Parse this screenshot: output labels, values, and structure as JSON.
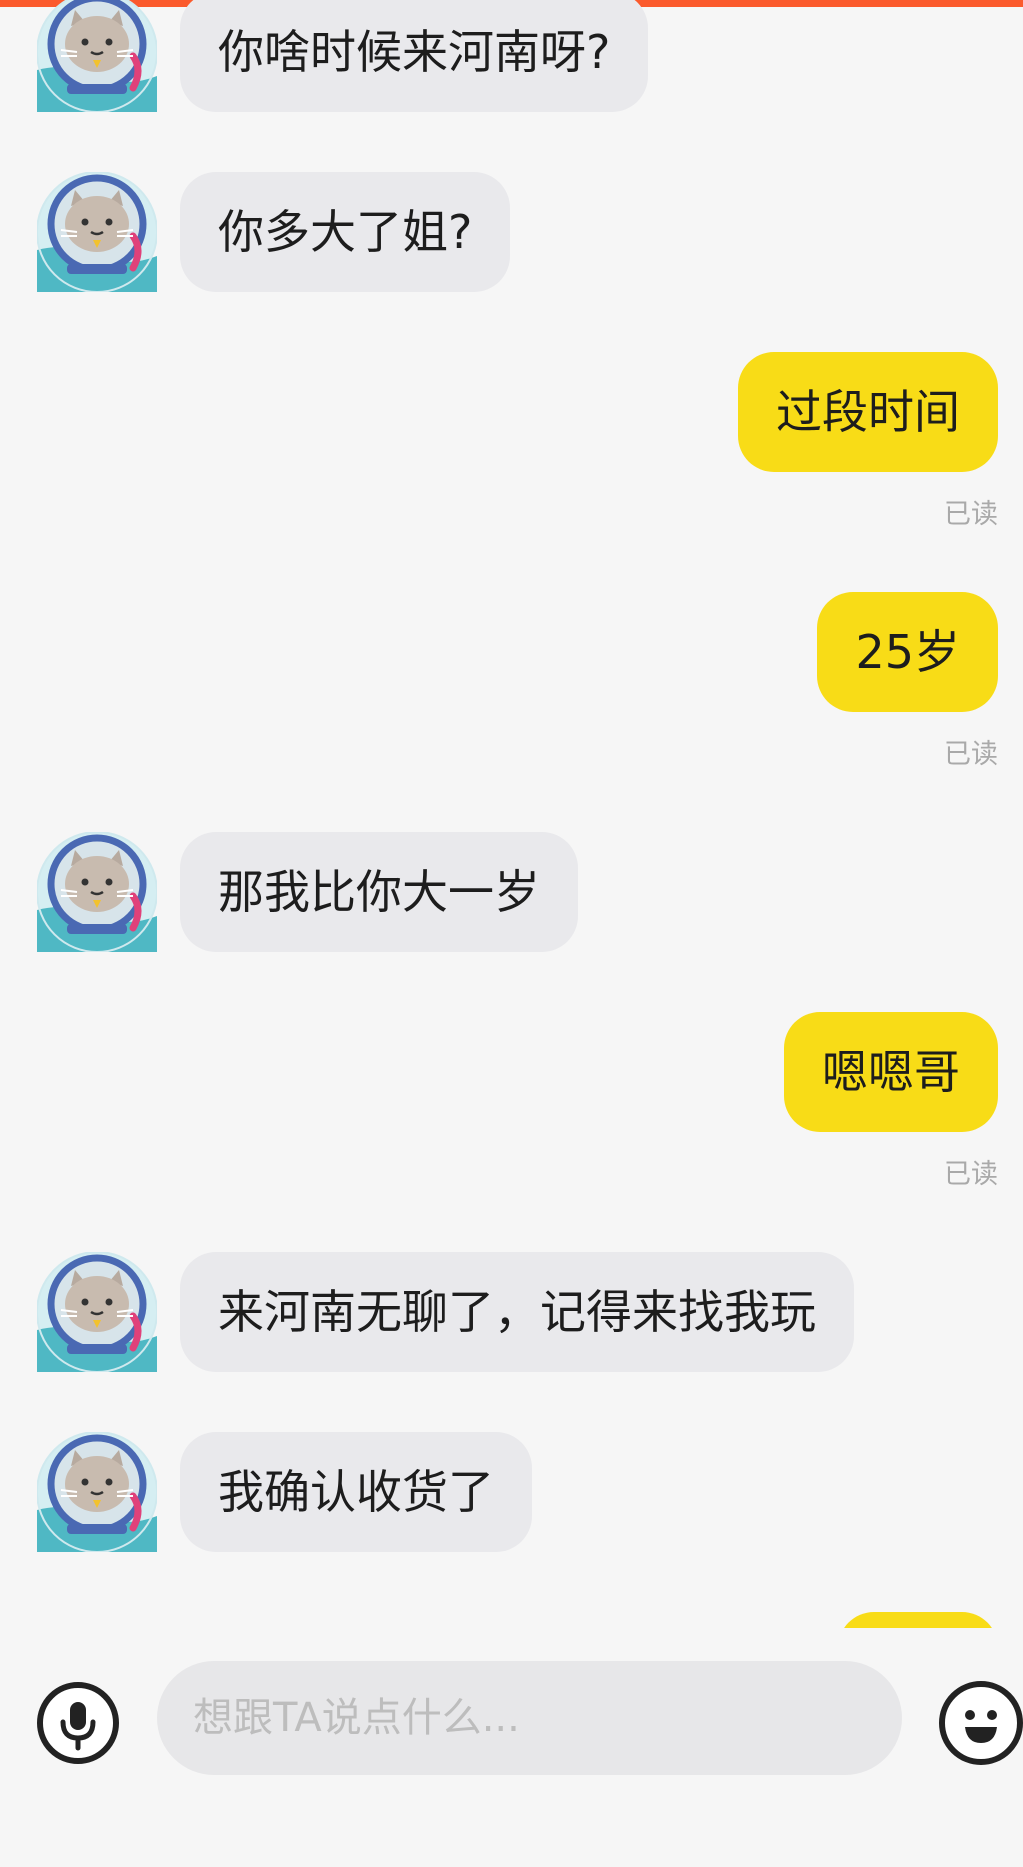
{
  "colors": {
    "accent_bar": "#fb5a2c",
    "self_bubble": "#f8dc17",
    "other_bubble": "#e9e9ec",
    "read_text": "#a9a9a9",
    "background": "#f6f6f6"
  },
  "messages": [
    {
      "from": "other",
      "text": "你啥时候来河南呀?"
    },
    {
      "from": "other",
      "text": "你多大了姐?"
    },
    {
      "from": "self",
      "text": "过段时间",
      "status": "已读"
    },
    {
      "from": "self",
      "text": "25岁",
      "status": "已读"
    },
    {
      "from": "other",
      "text": "那我比你大一岁"
    },
    {
      "from": "self",
      "text": "嗯嗯哥",
      "status": "已读"
    },
    {
      "from": "other",
      "text": "来河南无聊了，记得来找我玩"
    },
    {
      "from": "other",
      "text": "我确认收货了"
    }
  ],
  "composer": {
    "placeholder": "想跟TA说点什么...",
    "mic_icon": "microphone-icon",
    "emoji_icon": "smiley-face-icon"
  },
  "avatar_icon": "cat-astronaut-avatar"
}
